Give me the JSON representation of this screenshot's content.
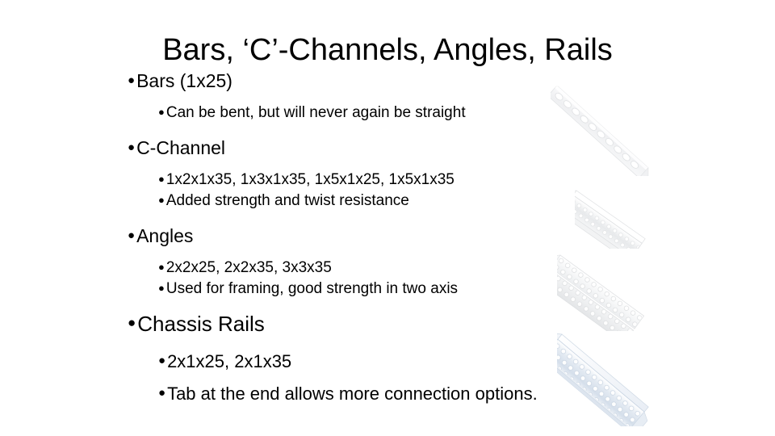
{
  "slide": {
    "title": "Bars, ‘C’-Channels, Angles, Rails",
    "background_color": "#ffffff",
    "text_color": "#000000",
    "bullet_glyph": "●"
  },
  "content": {
    "groups": [
      {
        "heading": "Bars (1x25)",
        "items": [
          "Can be bent, but will never again be straight"
        ]
      },
      {
        "heading": "C-Channel",
        "items": [
          "1x2x1x35, 1x3x1x35, 1x5x1x25, 1x5x1x35",
          "Added strength and twist resistance"
        ]
      },
      {
        "heading": "Angles",
        "items": [
          "2x2x25, 2x2x35, 3x3x35",
          "Used for framing, good strength in two axis"
        ]
      },
      {
        "heading": "Chassis Rails",
        "items": [
          "2x1x25, 2x1x35",
          "Tab at the end allows more connection options."
        ]
      }
    ]
  },
  "images": [
    {
      "name": "perforated-bar-photo",
      "alt": "Perforated flat metal bar with oval holes",
      "tint": "#f2f3f5"
    },
    {
      "name": "c-channel-photo",
      "alt": "Perforated C-channel section",
      "tint": "#e6e8ea"
    },
    {
      "name": "angle-photo",
      "alt": "Perforated angle bracket",
      "tint": "#e9ebed"
    },
    {
      "name": "chassis-rail-photo",
      "alt": "Perforated chassis rail with end tab",
      "tint": "#dfe6ee"
    }
  ]
}
